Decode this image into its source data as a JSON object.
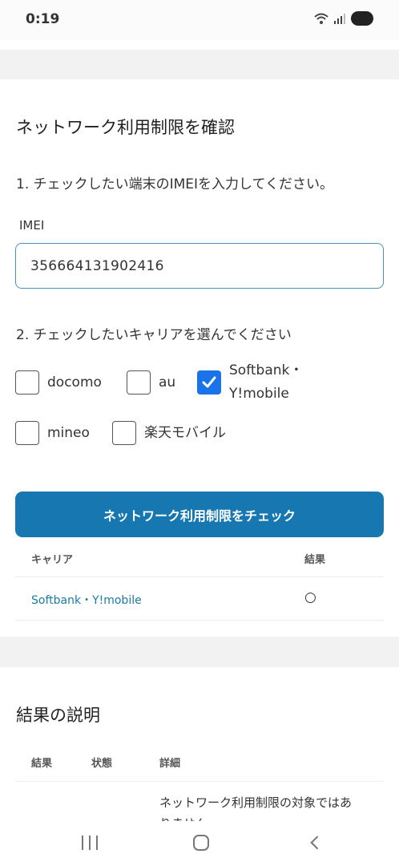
{
  "status_bar": {
    "time": "0:19"
  },
  "page": {
    "title": "ネットワーク利用制限を確認",
    "step1": "1. チェックしたい端末のIMEIを入力してください。",
    "imei_label": "IMEI",
    "imei_value": "356664131902416",
    "step2": "2. チェックしたいキャリアを選んでください",
    "carriers": [
      {
        "label": "docomo",
        "checked": false
      },
      {
        "label": "au",
        "checked": false
      },
      {
        "label_line1": "Softbank・",
        "label_line2": "Y!mobile",
        "checked": true
      },
      {
        "label": "mineo",
        "checked": false
      },
      {
        "label": "楽天モバイル",
        "checked": false
      }
    ],
    "check_button": "ネットワーク利用制限をチェック",
    "results_table": {
      "headers": [
        "キャリア",
        "結果"
      ],
      "rows": [
        {
          "carrier": "Softbank・Y!mobile",
          "result": "○"
        }
      ]
    }
  },
  "explanation": {
    "title": "結果の説明",
    "headers": [
      "結果",
      "状態",
      "詳細"
    ],
    "first_detail": "ネットワーク利用制限の対象ではあ",
    "first_detail_cont": "りません"
  },
  "colors": {
    "accent": "#1777b0",
    "checkbox": "#1a73e8",
    "link": "#1a7aa6"
  }
}
